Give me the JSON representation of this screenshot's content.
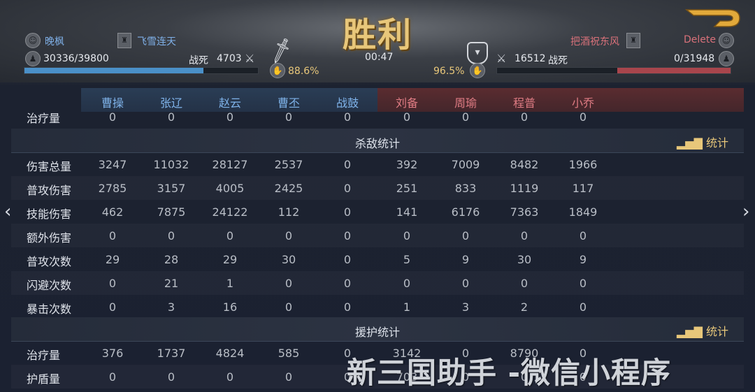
{
  "header": {
    "victory": "胜利",
    "timer": "00:47",
    "left": {
      "player": "晚枫",
      "guild": "飞雪连天",
      "troops": "30336/39800",
      "dead_label": "战死",
      "dead_value": "4703",
      "pct": "88.6%",
      "troop_fill": 0.76
    },
    "right": {
      "player": "把酒祝东风",
      "delete_label": "Delete",
      "dead_value": "16512",
      "dead_label": "战死",
      "troops": "0/31948",
      "pct": "96.5%",
      "troop_fill": 0.0
    },
    "back_icon": "back-arrow-icon"
  },
  "heroes": {
    "blue": [
      "曹操",
      "张辽",
      "赵云",
      "曹丕",
      "战鼓"
    ],
    "red": [
      "刘备",
      "周瑜",
      "程普",
      "小乔"
    ]
  },
  "partial_row": {
    "label": "治疗量",
    "values": [
      "0",
      "0",
      "0",
      "0",
      "0",
      "0",
      "0",
      "0",
      "0"
    ]
  },
  "kill_section": {
    "title": "杀敌统计",
    "stat_label": "统计"
  },
  "kill_rows": [
    {
      "label": "伤害总量",
      "values": [
        "3247",
        "11032",
        "28127",
        "2537",
        "0",
        "392",
        "7009",
        "8482",
        "1966"
      ]
    },
    {
      "label": "普攻伤害",
      "values": [
        "2785",
        "3157",
        "4005",
        "2425",
        "0",
        "251",
        "833",
        "1119",
        "117"
      ]
    },
    {
      "label": "技能伤害",
      "values": [
        "462",
        "7875",
        "24122",
        "112",
        "0",
        "141",
        "6176",
        "7363",
        "1849"
      ]
    },
    {
      "label": "额外伤害",
      "values": [
        "0",
        "0",
        "0",
        "0",
        "0",
        "0",
        "0",
        "0",
        "0"
      ]
    },
    {
      "label": "普攻次数",
      "values": [
        "29",
        "28",
        "29",
        "30",
        "0",
        "5",
        "9",
        "30",
        "9"
      ]
    },
    {
      "label": "闪避次数",
      "values": [
        "0",
        "21",
        "1",
        "0",
        "0",
        "0",
        "0",
        "0",
        "0"
      ]
    },
    {
      "label": "暴击次数",
      "values": [
        "0",
        "3",
        "16",
        "0",
        "0",
        "1",
        "3",
        "2",
        "0"
      ]
    }
  ],
  "assist_section": {
    "title": "援护统计",
    "stat_label": "统计"
  },
  "assist_rows": [
    {
      "label": "治疗量",
      "values": [
        "376",
        "1737",
        "4824",
        "585",
        "0",
        "3142",
        "0",
        "8790",
        "0"
      ]
    },
    {
      "label": "护盾量",
      "values": [
        "0",
        "0",
        "0",
        "0",
        "0",
        "703",
        "0",
        "0",
        "0"
      ]
    }
  ],
  "watermark": "新三国助手 -微信小程序",
  "colors": {
    "blue": "#7fb3ea",
    "red": "#e07c84",
    "gold": "#e8c77a"
  }
}
